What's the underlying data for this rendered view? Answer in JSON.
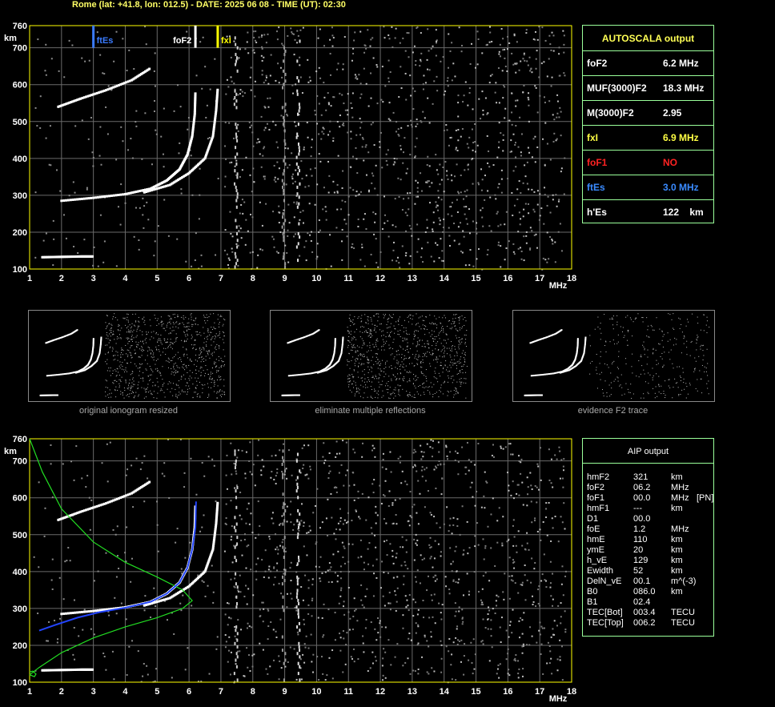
{
  "header": "Rome (lat: +41.8, lon: 012.5) - DATE: 2025 06 08 - TIME (UT): 02:30",
  "chart_data": [
    {
      "type": "scatter",
      "name": "main-ionogram",
      "xlabel": "MHz",
      "ylabel": "km",
      "xlim": [
        1,
        18
      ],
      "ylim": [
        100,
        760
      ],
      "x_ticks": [
        "1",
        "2",
        "3",
        "4",
        "5",
        "6",
        "7",
        "8",
        "9",
        "10",
        "11",
        "12",
        "13",
        "14",
        "15",
        "16",
        "17",
        "18"
      ],
      "y_ticks": [
        "100",
        "200",
        "300",
        "400",
        "500",
        "600",
        "700",
        "760"
      ],
      "grid": true,
      "markers": [
        {
          "label": "ftEs",
          "x": 3.0,
          "color": "#3a7bff"
        },
        {
          "label": "foF2",
          "x": 6.2,
          "color": "#ffffff"
        },
        {
          "label": "fxI",
          "x": 6.9,
          "color": "#ffff00"
        }
      ],
      "traces": [
        {
          "name": "F2 ordinary",
          "points": [
            [
              2.0,
              285
            ],
            [
              3.0,
              293
            ],
            [
              4.0,
              303
            ],
            [
              4.8,
              318
            ],
            [
              5.3,
              340
            ],
            [
              5.7,
              370
            ],
            [
              5.95,
              410
            ],
            [
              6.1,
              460
            ],
            [
              6.18,
              520
            ],
            [
              6.2,
              580
            ]
          ]
        },
        {
          "name": "F2 extraordinary",
          "points": [
            [
              4.6,
              308
            ],
            [
              5.4,
              328
            ],
            [
              6.0,
              360
            ],
            [
              6.5,
              400
            ],
            [
              6.75,
              460
            ],
            [
              6.85,
              530
            ],
            [
              6.9,
              590
            ]
          ]
        },
        {
          "name": "F2 second hop",
          "points": [
            [
              1.9,
              540
            ],
            [
              2.6,
              562
            ],
            [
              3.4,
              585
            ],
            [
              4.2,
              612
            ],
            [
              4.8,
              645
            ]
          ]
        },
        {
          "name": "Es",
          "points": [
            [
              1.4,
              132
            ],
            [
              2.0,
              133
            ],
            [
              2.6,
              134
            ],
            [
              3.0,
              134
            ]
          ]
        }
      ]
    },
    {
      "type": "scatter",
      "name": "aip-ionogram",
      "xlabel": "MHz",
      "ylabel": "km",
      "xlim": [
        1,
        18
      ],
      "ylim": [
        100,
        760
      ],
      "x_ticks": [
        "1",
        "2",
        "3",
        "4",
        "5",
        "6",
        "7",
        "8",
        "9",
        "10",
        "11",
        "12",
        "13",
        "14",
        "15",
        "16",
        "17",
        "18"
      ],
      "y_ticks": [
        "100",
        "200",
        "300",
        "400",
        "500",
        "600",
        "700",
        "760"
      ],
      "grid": true,
      "profile_blue": [
        [
          1.3,
          240
        ],
        [
          1.8,
          255
        ],
        [
          2.5,
          275
        ],
        [
          3.2,
          290
        ],
        [
          4.0,
          302
        ],
        [
          4.8,
          318
        ],
        [
          5.3,
          340
        ],
        [
          5.7,
          370
        ],
        [
          5.95,
          410
        ],
        [
          6.1,
          460
        ],
        [
          6.2,
          520
        ],
        [
          6.22,
          590
        ]
      ],
      "profile_green": [
        [
          1.0,
          120
        ],
        [
          1.3,
          140
        ],
        [
          2.0,
          180
        ],
        [
          3.0,
          220
        ],
        [
          4.0,
          250
        ],
        [
          5.0,
          275
        ],
        [
          5.8,
          300
        ],
        [
          6.1,
          321
        ],
        [
          5.8,
          350
        ],
        [
          5.0,
          385
        ],
        [
          4.0,
          425
        ],
        [
          3.0,
          480
        ],
        [
          2.0,
          570
        ],
        [
          1.4,
          670
        ],
        [
          1.0,
          760
        ]
      ],
      "profile_green_low": [
        [
          1.0,
          120
        ],
        [
          1.15,
          115
        ],
        [
          1.2,
          122
        ],
        [
          1.1,
          130
        ],
        [
          1.0,
          128
        ]
      ]
    }
  ],
  "autoscala": {
    "title": "AUTOSCALA output",
    "rows": [
      {
        "label": "foF2",
        "value": "6.2 MHz",
        "color": "#ffffff"
      },
      {
        "label": "MUF(3000)F2",
        "value": "18.3 MHz",
        "color": "#ffffff"
      },
      {
        "label": "M(3000)F2",
        "value": "2.95",
        "color": "#ffffff"
      },
      {
        "label": "fxI",
        "value": "6.9 MHz",
        "color": "#ffff44"
      },
      {
        "label": "foF1",
        "value": "NO",
        "color": "#ff2222"
      },
      {
        "label": "ftEs",
        "value": "3.0 MHz",
        "color": "#3a8bff"
      },
      {
        "label": "h'Es",
        "value": "122    km",
        "color": "#ffffff"
      }
    ]
  },
  "thumbnails": [
    {
      "caption": "original ionogram resized"
    },
    {
      "caption": "eliminate multiple reflections"
    },
    {
      "caption": "evidence F2 trace"
    }
  ],
  "aip": {
    "title": "AIP output",
    "rows": [
      {
        "name": "hmF2",
        "value": "321",
        "unit": "km",
        "extra": ""
      },
      {
        "name": "foF2",
        "value": "06.2",
        "unit": "MHz",
        "extra": ""
      },
      {
        "name": "foF1",
        "value": "00.0",
        "unit": "MHz",
        "extra": "[PN]"
      },
      {
        "name": "hmF1",
        "value": "---",
        "unit": "km",
        "extra": ""
      },
      {
        "name": "D1",
        "value": "00.0",
        "unit": "",
        "extra": ""
      },
      {
        "name": "foE",
        "value": "1.2",
        "unit": "MHz",
        "extra": ""
      },
      {
        "name": "hmE",
        "value": "110",
        "unit": "km",
        "extra": ""
      },
      {
        "name": "ymE",
        "value": "20",
        "unit": "km",
        "extra": ""
      },
      {
        "name": "h_vE",
        "value": "129",
        "unit": "km",
        "extra": ""
      },
      {
        "name": "Ewidth",
        "value": "52",
        "unit": "km",
        "extra": ""
      },
      {
        "name": "DelN_vE",
        "value": "00.1",
        "unit": "m^(-3)",
        "extra": ""
      },
      {
        "name": "B0",
        "value": "086.0",
        "unit": "km",
        "extra": ""
      },
      {
        "name": "B1",
        "value": "02.4",
        "unit": "",
        "extra": ""
      },
      {
        "name": "TEC[Bot]",
        "value": "003.4",
        "unit": "TECU",
        "extra": ""
      },
      {
        "name": "TEC[Top]",
        "value": "006.2",
        "unit": "TECU",
        "extra": ""
      }
    ]
  }
}
